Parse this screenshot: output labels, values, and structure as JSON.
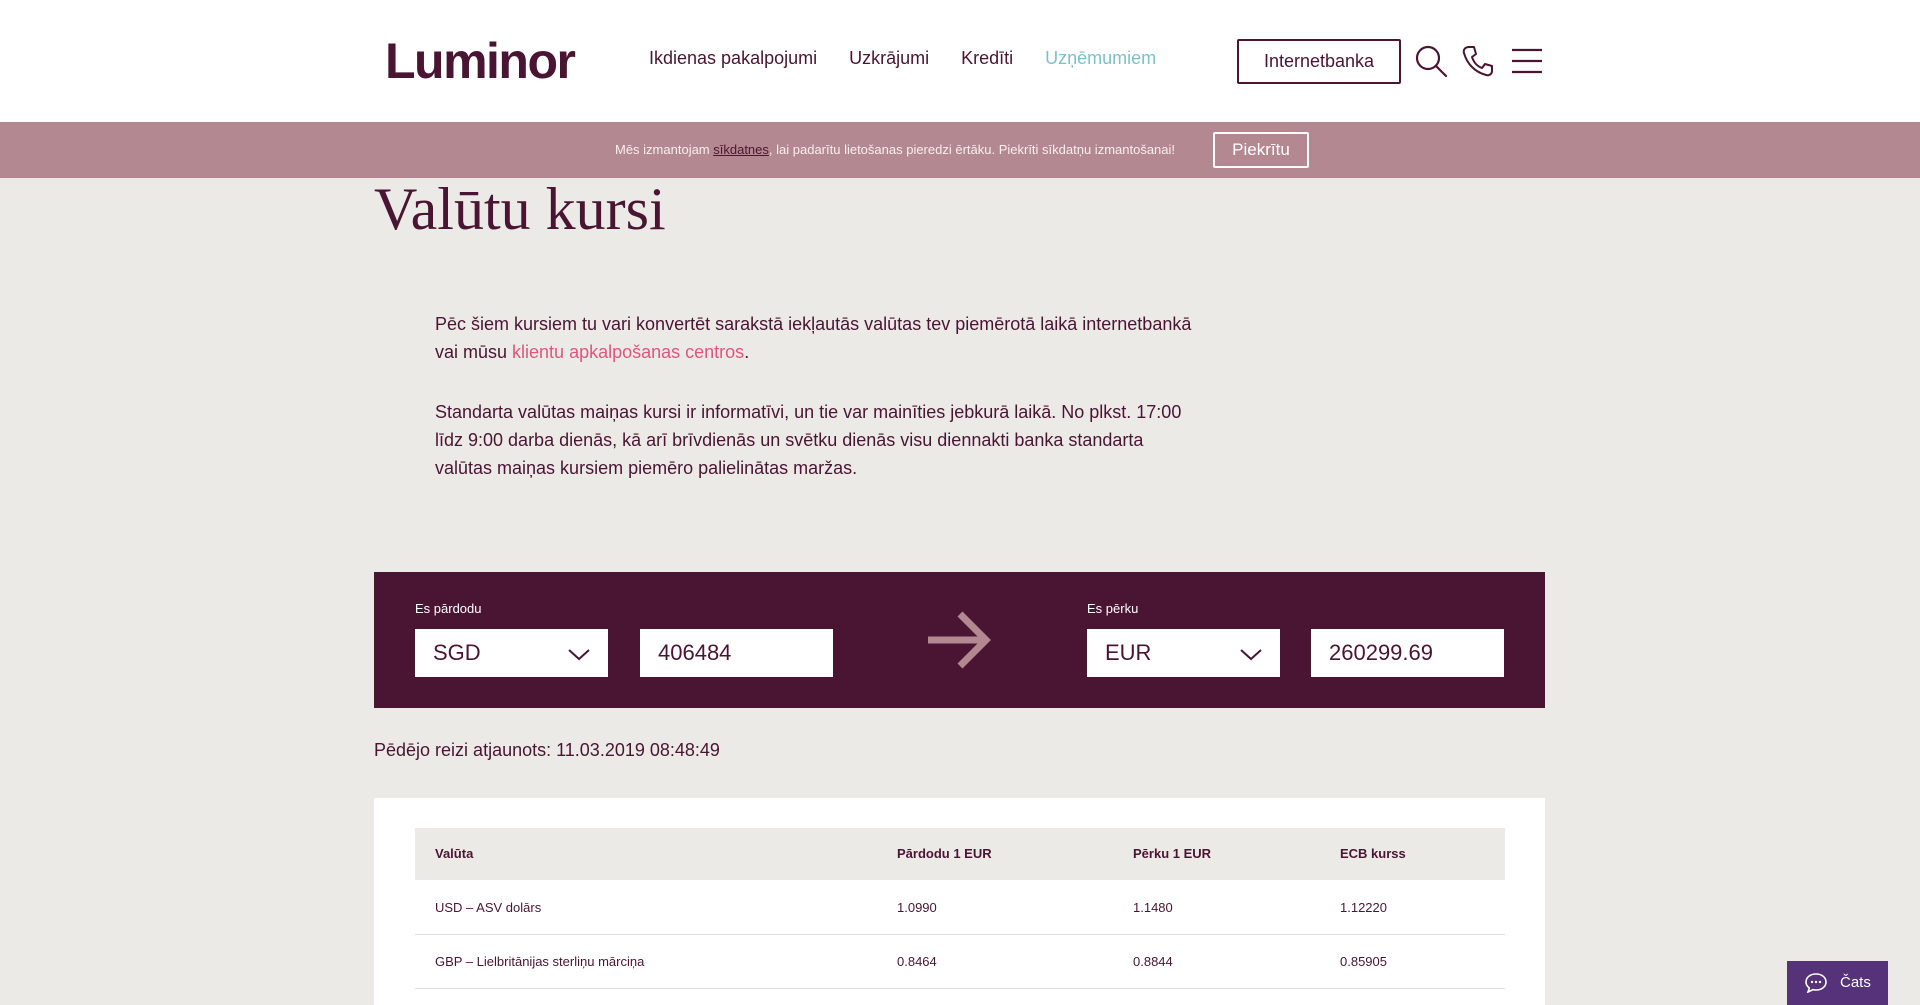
{
  "header": {
    "logo": "Luminor",
    "nav": [
      "Ikdienas pakalpojumi",
      "Uzkrājumi",
      "Kredīti",
      "Uzņēmumiem"
    ],
    "internetbank_label": "Internetbanka",
    "icons": [
      "search-icon",
      "phone-icon",
      "menu-icon"
    ]
  },
  "cookie": {
    "text_before": "Mēs izmantojam ",
    "link": "sīkdatnes",
    "text_after": ", lai padarītu lietošanas pieredzi ērtāku. Piekrīti sīkdatņu izmantošanai!",
    "button": "Piekrītu"
  },
  "page": {
    "title": "Valūtu kursi",
    "intro_before": "Pēc šiem kursiem tu vari konvertēt sarakstā iekļautās valūtas tev piemērotā laikā internetbankā vai mūsu ",
    "intro_link": "klientu apkalpošanas centros",
    "intro_after": ".",
    "notice": "Standarta valūtas maiņas kursi ir informatīvi, un tie var mainīties jebkurā laikā. No plkst. 17:00 līdz 9:00 darba dienās, kā arī brīvdienās un svētku dienās visu diennakti banka standarta valūtas maiņas kursiem piemēro palielinātas maržas."
  },
  "converter": {
    "sell_label": "Es pārdodu",
    "sell_currency": "SGD",
    "sell_amount": "406484",
    "buy_label": "Es pērku",
    "buy_currency": "EUR",
    "buy_amount": "260299.69"
  },
  "updated": "Pēdējo reizi atjaunots: 11.03.2019 08:48:49",
  "table": {
    "headers": [
      "Valūta",
      "Pārdodu 1 EUR",
      "Pērku 1 EUR",
      "ECB kurss"
    ],
    "rows": [
      [
        "USD – ASV dolārs",
        "1.0990",
        "1.1480",
        "1.12220"
      ],
      [
        "GBP – Lielbritānijas sterliņu mārciņa",
        "0.8464",
        "0.8844",
        "0.85905"
      ]
    ]
  },
  "chat": {
    "label": "Čats"
  },
  "colors": {
    "brand": "#4a1533",
    "accent_pink": "#e0567a",
    "active_nav": "#7dc0cb",
    "cookie_bg": "#b48890",
    "chat_bg": "#56327b"
  }
}
